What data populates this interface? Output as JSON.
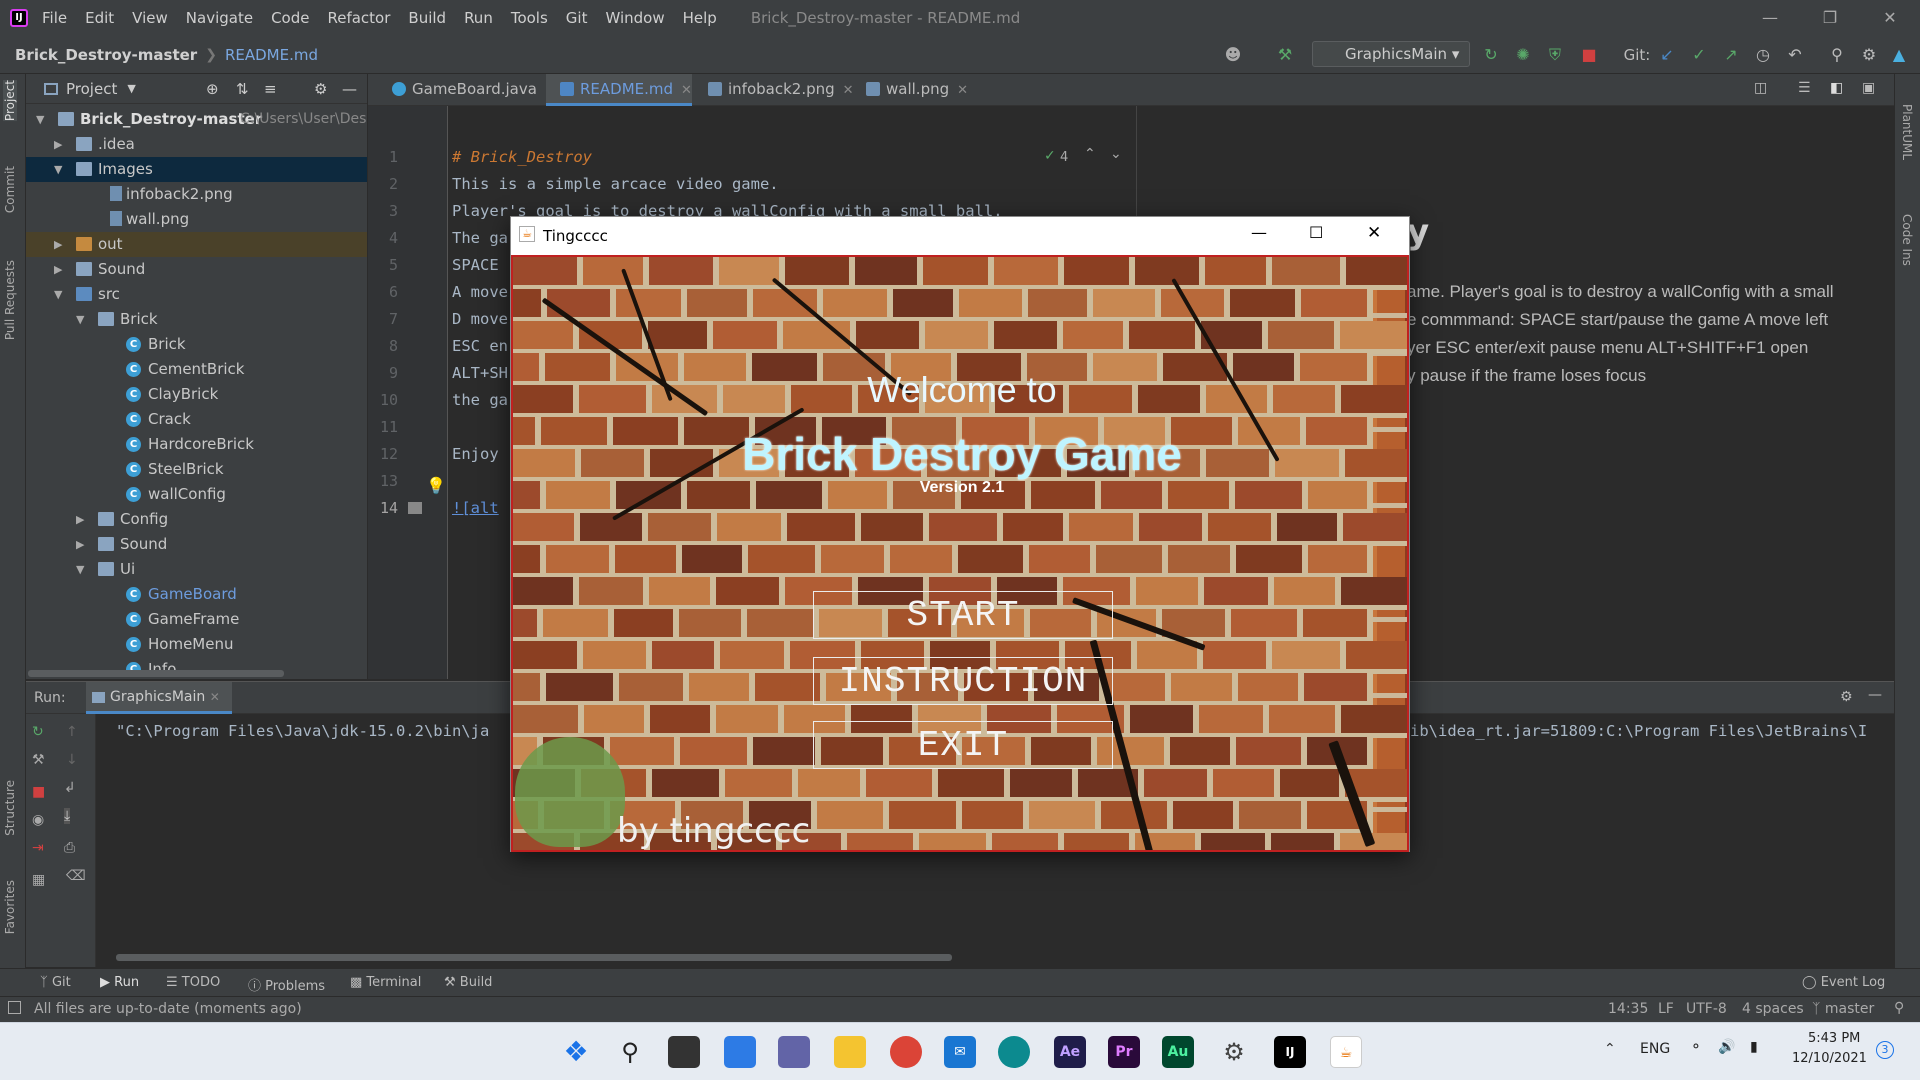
{
  "menubar": {
    "items": [
      "File",
      "Edit",
      "View",
      "Navigate",
      "Code",
      "Refactor",
      "Build",
      "Run",
      "Tools",
      "Git",
      "Window",
      "Help"
    ],
    "window_title": "Brick_Destroy-master - README.md"
  },
  "navbar": {
    "project": "Brick_Destroy-master",
    "file": "README.md",
    "run_config": "GraphicsMain",
    "git_label": "Git:"
  },
  "project_panel": {
    "title": "Project",
    "root_name": "Brick_Destroy-master",
    "root_path": "C:\\Users\\User\\Deskt",
    "items": [
      ".idea",
      "Images",
      "infoback2.png",
      "wall.png",
      "out",
      "Sound",
      "src",
      "Brick",
      "Brick",
      "CementBrick",
      "ClayBrick",
      "Crack",
      "HardcoreBrick",
      "SteelBrick",
      "wallConfig",
      "Config",
      "Sound",
      "Ui",
      "GameBoard",
      "GameFrame",
      "HomeMenu",
      "Info"
    ]
  },
  "editor_tabs": [
    "GameBoard.java",
    "README.md",
    "infoback2.png",
    "wall.png"
  ],
  "editor": {
    "line_numbers": [
      "1",
      "2",
      "3",
      "4",
      "5",
      "6",
      "7",
      "8",
      "9",
      "10",
      "11",
      "12",
      "13",
      "14"
    ],
    "lines": [
      "# Brick_Destroy",
      "This is a simple arcace video game.",
      "Player's goal is to destroy a wallConfig with a small ball.",
      "The ga",
      "SPACE",
      "A move",
      "D move",
      "ESC en",
      "ALT+SH",
      "the ga",
      "",
      "Enjoy",
      "",
      "![alt"
    ],
    "inspection_count": "4"
  },
  "preview": {
    "heading": "y",
    "lines": [
      "ame. Player's goal is to destroy a wallConfig with a small",
      "e commmand: SPACE start/pause the game A move left",
      "yer ESC enter/exit pause menu ALT+SHITF+F1 open",
      "y pause if the frame loses focus"
    ]
  },
  "run_panel": {
    "label": "Run:",
    "tab": "GraphicsMain",
    "console_left": "\"C:\\Program Files\\Java\\jdk-15.0.2\\bin\\ja",
    "console_right": "ib\\idea_rt.jar=51809:C:\\Program Files\\JetBrains\\I"
  },
  "toolwindows": [
    "Git",
    "Run",
    "TODO",
    "Problems",
    "Terminal",
    "Build"
  ],
  "event_log": "Event Log",
  "status": {
    "message": "All files are up-to-date (moments ago)",
    "position": "14:35",
    "line_sep": "LF",
    "encoding": "UTF-8",
    "indent": "4 spaces",
    "branch": "master"
  },
  "side_tabs_left": [
    "Project",
    "Commit",
    "Pull Requests",
    "Structure",
    "Favorites"
  ],
  "side_tabs_right": [
    "PlantUML",
    "Code Ins"
  ],
  "game_window": {
    "title": "Tingcccc",
    "welcome": "Welcome to",
    "game_title": "Brick Destroy Game",
    "version": "Version 2.1",
    "buttons": [
      "START",
      "INSTRUCTION",
      "EXIT"
    ],
    "byline": "by tingcccc"
  },
  "taskbar": {
    "lang": "ENG",
    "time": "5:43 PM",
    "date": "12/10/2021",
    "notifications": "3"
  }
}
